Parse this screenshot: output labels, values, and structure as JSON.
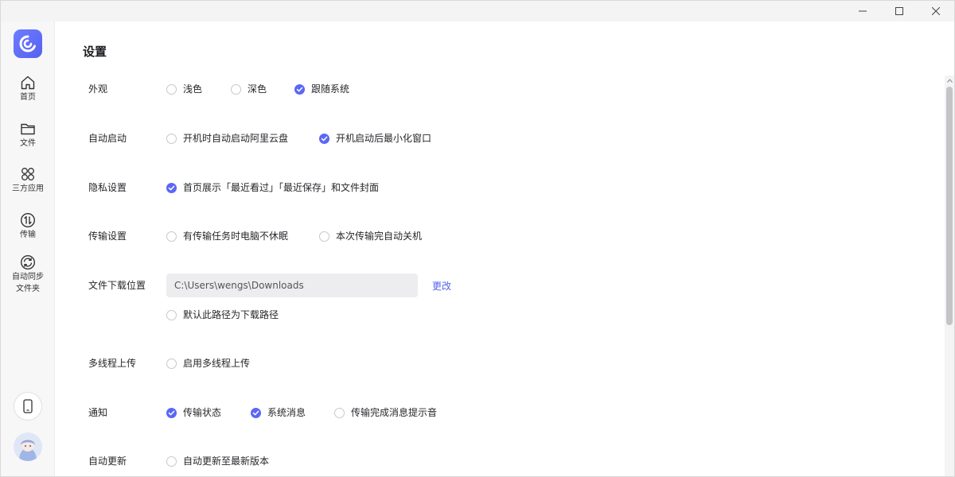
{
  "window": {
    "minimize_icon": "minimize-icon",
    "maximize_icon": "maximize-icon",
    "close_icon": "close-icon"
  },
  "sidebar": {
    "items": [
      {
        "label": "首页",
        "icon": "home-icon"
      },
      {
        "label": "文件",
        "icon": "folder-icon"
      },
      {
        "label": "三方应用",
        "icon": "apps-icon"
      },
      {
        "label": "传输",
        "icon": "transfer-icon"
      },
      {
        "label": "自动同步",
        "label2": "文件夹",
        "icon": "sync-icon"
      }
    ],
    "bottom": {
      "phone_icon": "phone-icon",
      "avatar": "avatar"
    }
  },
  "settings": {
    "title": "设置",
    "appearance": {
      "label": "外观",
      "options": [
        {
          "label": "浅色",
          "checked": false
        },
        {
          "label": "深色",
          "checked": false
        },
        {
          "label": "跟随系统",
          "checked": true
        }
      ]
    },
    "autostart": {
      "label": "自动启动",
      "options": [
        {
          "label": "开机时自动启动阿里云盘",
          "checked": false
        },
        {
          "label": "开机启动后最小化窗口",
          "checked": true
        }
      ]
    },
    "privacy": {
      "label": "隐私设置",
      "options": [
        {
          "label": "首页展示「最近看过」「最近保存」和文件封面",
          "checked": true
        }
      ]
    },
    "transfer": {
      "label": "传输设置",
      "options": [
        {
          "label": "有传输任务时电脑不休眠",
          "checked": false
        },
        {
          "label": "本次传输完自动关机",
          "checked": false
        }
      ]
    },
    "download": {
      "label": "文件下载位置",
      "path": "C:\\Users\\wengs\\Downloads",
      "change": "更改",
      "options": [
        {
          "label": "默认此路径为下载路径",
          "checked": false
        }
      ]
    },
    "multithread": {
      "label": "多线程上传",
      "options": [
        {
          "label": "启用多线程上传",
          "checked": false
        }
      ]
    },
    "notify": {
      "label": "通知",
      "options": [
        {
          "label": "传输状态",
          "checked": true
        },
        {
          "label": "系统消息",
          "checked": true
        },
        {
          "label": "传输完成消息提示音",
          "checked": false
        }
      ]
    },
    "update": {
      "label": "自动更新",
      "options": [
        {
          "label": "自动更新至最新版本",
          "checked": false
        }
      ]
    }
  },
  "colors": {
    "accent": "#5b67f5",
    "link": "#5561f0"
  }
}
